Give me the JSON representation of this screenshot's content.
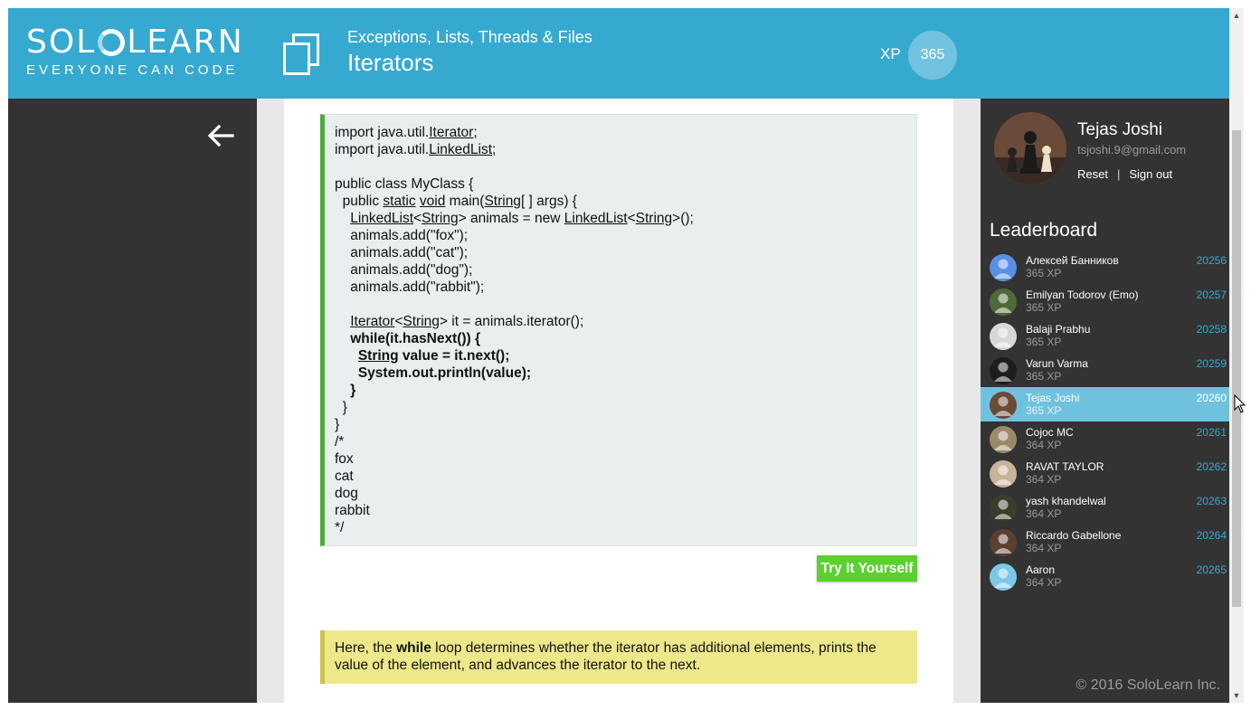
{
  "header": {
    "logo_left": "SOL",
    "logo_right": "LEARN",
    "tagline": "EVERYONE CAN CODE",
    "course_title": "Exceptions, Lists, Threads & Files",
    "lesson_title": "Iterators",
    "xp_label": "XP",
    "xp_value": "365"
  },
  "code": {
    "lines": [
      {
        "segs": [
          {
            "t": "import java.util."
          },
          {
            "t": "Iterator",
            "u": true
          },
          {
            "t": ";"
          }
        ]
      },
      {
        "segs": [
          {
            "t": "import java.util."
          },
          {
            "t": "LinkedList",
            "u": true
          },
          {
            "t": ";"
          }
        ]
      },
      {
        "segs": [
          {
            "t": ""
          }
        ]
      },
      {
        "segs": [
          {
            "t": "public class MyClass {"
          }
        ]
      },
      {
        "segs": [
          {
            "t": "  public "
          },
          {
            "t": "static",
            "u": true
          },
          {
            "t": " "
          },
          {
            "t": "void",
            "u": true
          },
          {
            "t": " main("
          },
          {
            "t": "String",
            "u": true
          },
          {
            "t": "[ ] args) {"
          }
        ]
      },
      {
        "segs": [
          {
            "t": "    "
          },
          {
            "t": "LinkedList",
            "u": true
          },
          {
            "t": "<"
          },
          {
            "t": "String",
            "u": true
          },
          {
            "t": "> animals = new "
          },
          {
            "t": "LinkedList",
            "u": true
          },
          {
            "t": "<"
          },
          {
            "t": "String",
            "u": true
          },
          {
            "t": ">();"
          }
        ]
      },
      {
        "segs": [
          {
            "t": "    animals.add(\"fox\");"
          }
        ]
      },
      {
        "segs": [
          {
            "t": "    animals.add(\"cat\");"
          }
        ]
      },
      {
        "segs": [
          {
            "t": "    animals.add(\"dog\");"
          }
        ]
      },
      {
        "segs": [
          {
            "t": "    animals.add(\"rabbit\");"
          }
        ]
      },
      {
        "segs": [
          {
            "t": ""
          }
        ]
      },
      {
        "segs": [
          {
            "t": "    "
          },
          {
            "t": "Iterator",
            "u": true
          },
          {
            "t": "<"
          },
          {
            "t": "String",
            "u": true
          },
          {
            "t": "> it = animals.iterator();"
          }
        ]
      },
      {
        "bold": true,
        "segs": [
          {
            "t": "    while(it.hasNext()) {"
          }
        ]
      },
      {
        "bold": true,
        "segs": [
          {
            "t": "      "
          },
          {
            "t": "String",
            "u": true
          },
          {
            "t": " value = it.next();"
          }
        ]
      },
      {
        "bold": true,
        "segs": [
          {
            "t": "      System.out.println(value);"
          }
        ]
      },
      {
        "bold": true,
        "segs": [
          {
            "t": "    }"
          }
        ]
      },
      {
        "segs": [
          {
            "t": "  }"
          }
        ]
      },
      {
        "segs": [
          {
            "t": "}"
          }
        ]
      },
      {
        "segs": [
          {
            "t": "/*"
          }
        ]
      },
      {
        "segs": [
          {
            "t": "fox"
          }
        ]
      },
      {
        "segs": [
          {
            "t": "cat"
          }
        ]
      },
      {
        "segs": [
          {
            "t": "dog"
          }
        ]
      },
      {
        "segs": [
          {
            "t": "rabbit"
          }
        ]
      },
      {
        "segs": [
          {
            "t": "*/"
          }
        ]
      }
    ]
  },
  "try_button_label": "Try It Yourself",
  "note": {
    "before": "Here, the ",
    "keyword": "while",
    "after": " loop determines whether the iterator has additional elements, prints the value of the element, and advances the iterator to the next."
  },
  "profile": {
    "name": "Tejas Joshi",
    "email": "tsjoshi.9@gmail.com",
    "reset_label": "Reset",
    "separator": "|",
    "signout_label": "Sign out"
  },
  "leaderboard": {
    "title": "Leaderboard",
    "entries": [
      {
        "name": "Алексей Банников",
        "xp": "365 XP",
        "rank": "20256",
        "avatar_color": "#5a8fe6",
        "active": false
      },
      {
        "name": "Emilyan Todorov (Emo)",
        "xp": "365 XP",
        "rank": "20257",
        "avatar_color": "#4f6b3a",
        "active": false
      },
      {
        "name": "Balaji Prabhu",
        "xp": "365 XP",
        "rank": "20258",
        "avatar_color": "#d8d8d8",
        "active": false
      },
      {
        "name": "Varun Varma",
        "xp": "365 XP",
        "rank": "20259",
        "avatar_color": "#1e1e1e",
        "active": false
      },
      {
        "name": "Tejas Joshi",
        "xp": "365 XP",
        "rank": "20260",
        "avatar_color": "#6b4a36",
        "active": true
      },
      {
        "name": "Cojoc MC",
        "xp": "364 XP",
        "rank": "20261",
        "avatar_color": "#9b8a6a",
        "active": false
      },
      {
        "name": "RAVAT TAYLOR",
        "xp": "364 XP",
        "rank": "20262",
        "avatar_color": "#c9b49a",
        "active": false
      },
      {
        "name": "yash khandelwal",
        "xp": "364 XP",
        "rank": "20263",
        "avatar_color": "#3a3d2a",
        "active": false
      },
      {
        "name": "Riccardo Gabellone",
        "xp": "364 XP",
        "rank": "20264",
        "avatar_color": "#5b4030",
        "active": false
      },
      {
        "name": "Aaron",
        "xp": "364 XP",
        "rank": "20265",
        "avatar_color": "#7dc8e8",
        "active": false
      }
    ]
  },
  "copyright": "© 2016 SoloLearn Inc.",
  "colors": {
    "header": "#36a9d0",
    "dark_panel": "#333333",
    "code_border": "#4eab3e",
    "try_button": "#5bd12e",
    "note_bg": "#ede98b",
    "rank_text": "#36a9d0",
    "active_row": "#6fc2dd"
  },
  "icons": {
    "lesson": "copy-pages-icon",
    "back": "back-arrow-icon",
    "scroll_up": "scroll-up-icon",
    "scroll_down": "scroll-down-icon",
    "cursor": "mouse-cursor-icon"
  }
}
